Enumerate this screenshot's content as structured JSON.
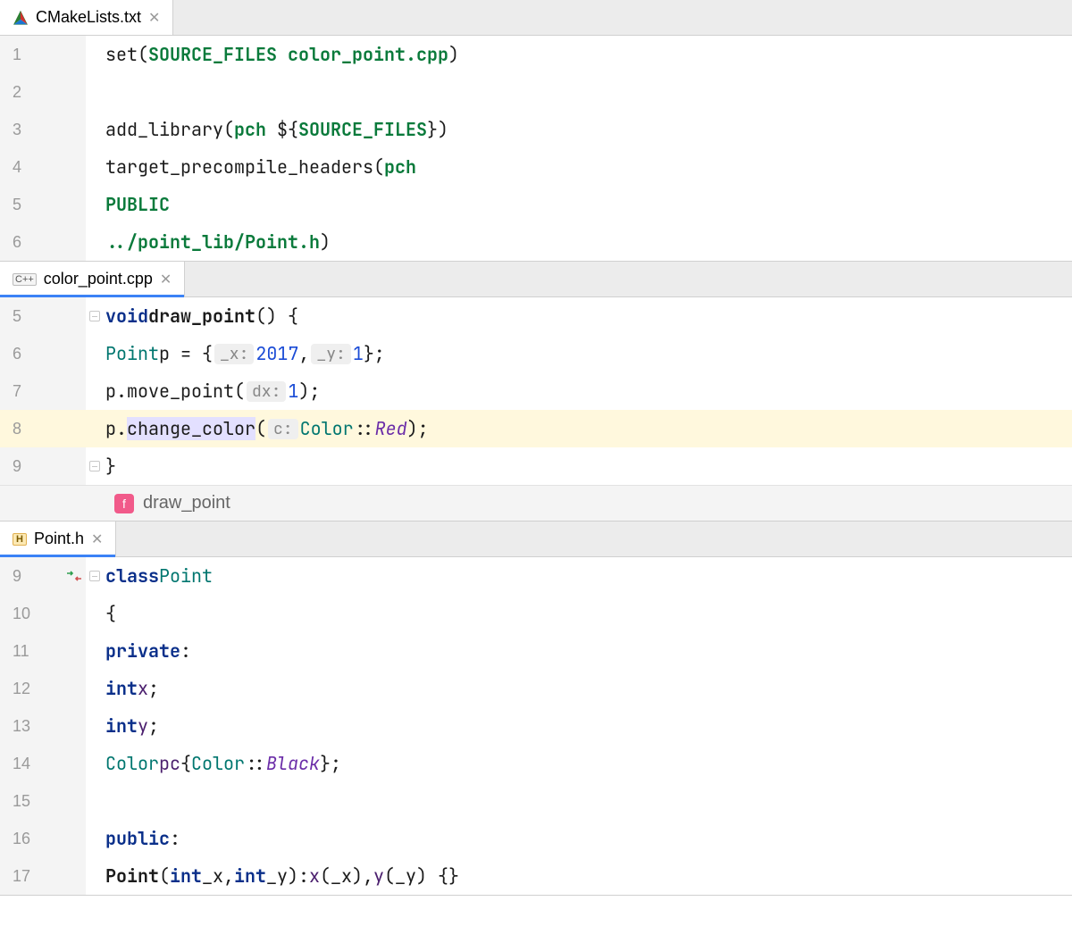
{
  "pane1": {
    "tab": {
      "filename": "CMakeLists.txt"
    },
    "lines": [
      {
        "n": "1",
        "html": "<span class='plain'>set(</span><span class='str-green'>SOURCE_FILES color_point.cpp</span><span class='plain'>)</span>"
      },
      {
        "n": "2",
        "html": ""
      },
      {
        "n": "3",
        "html": "<span class='plain'>add_library(</span><span class='str-green'>pch </span><span class='plain'>${</span><span class='str-green'>SOURCE_FILES</span><span class='plain'>}</span><span class='plain'>)</span>"
      },
      {
        "n": "4",
        "html": "<span class='plain'>target_precompile_headers(</span><span class='str-green'>pch</span>"
      },
      {
        "n": "5",
        "html": "        <span class='str-green'>PUBLIC</span>"
      },
      {
        "n": "6",
        "html": "            <span class='str-green'>../point_lib/Point.h</span><span class='plain'>)</span>"
      }
    ]
  },
  "pane2": {
    "tab": {
      "filename": "color_point.cpp"
    },
    "breadcrumb": {
      "icon": "f",
      "label": "draw_point"
    },
    "lines": [
      {
        "n": "5",
        "fold": "open",
        "html": "<span class='kw'>void</span> <span class='plain bold'>draw_point</span><span class='plain'>() {</span>"
      },
      {
        "n": "6",
        "html": "    <span class='type'>Point</span> <span class='plain'>p = {</span> <span class='param-hint'>_x:</span> <span class='num'>2017</span><span class='plain'>,</span>  <span class='param-hint'>_y:</span> <span class='num'>1</span><span class='plain'>};</span>"
      },
      {
        "n": "7",
        "html": "    <span class='plain'>p.move_point(</span> <span class='param-hint'>dx:</span> <span class='num'>1</span><span class='plain'>);</span>"
      },
      {
        "n": "8",
        "hl": true,
        "html": "    <span class='plain'>p.</span><span class='plain hlspan'>change_color</span><span class='plain'>(</span> <span class='param-hint'>c:</span> <span class='type'>Color</span><span class='plain'>::</span><span class='enum'>Red</span><span class='plain'>);</span>"
      },
      {
        "n": "9",
        "fold": "close",
        "html": "<span class='plain'>}</span>"
      }
    ]
  },
  "pane3": {
    "tab": {
      "filename": "Point.h"
    },
    "lines": [
      {
        "n": "9",
        "vcs": true,
        "fold": "open",
        "html": "<span class='kw'>class</span> <span class='type'>Point</span>"
      },
      {
        "n": "10",
        "html": "<span class='plain'>{</span>"
      },
      {
        "n": "11",
        "html": "<span class='kw'>private</span><span class='plain'>:</span>"
      },
      {
        "n": "12",
        "html": "    <span class='kw'>int</span>   <span class='mem'>x</span><span class='plain'>;</span>"
      },
      {
        "n": "13",
        "html": "    <span class='kw'>int</span>   <span class='mem'>y</span><span class='plain'>;</span>"
      },
      {
        "n": "14",
        "html": "    <span class='type'>Color</span> <span class='mem'>pc</span><span class='plain'>{</span><span class='type'>Color</span><span class='plain'>::</span><span class='enum'>Black</span><span class='plain'>};</span>"
      },
      {
        "n": "15",
        "html": ""
      },
      {
        "n": "16",
        "html": "<span class='kw'>public</span><span class='plain'>:</span>"
      },
      {
        "n": "17",
        "html": "    <span class='plain bold'>Point</span><span class='plain'>(</span><span class='kw'>int</span> <span class='plain'>_x,</span> <span class='kw'>int</span> <span class='plain'>_y):</span> <span class='mem'>x</span><span class='plain'>(_x),</span> <span class='mem'>y</span><span class='plain'>(_y) {}</span>"
      }
    ]
  }
}
